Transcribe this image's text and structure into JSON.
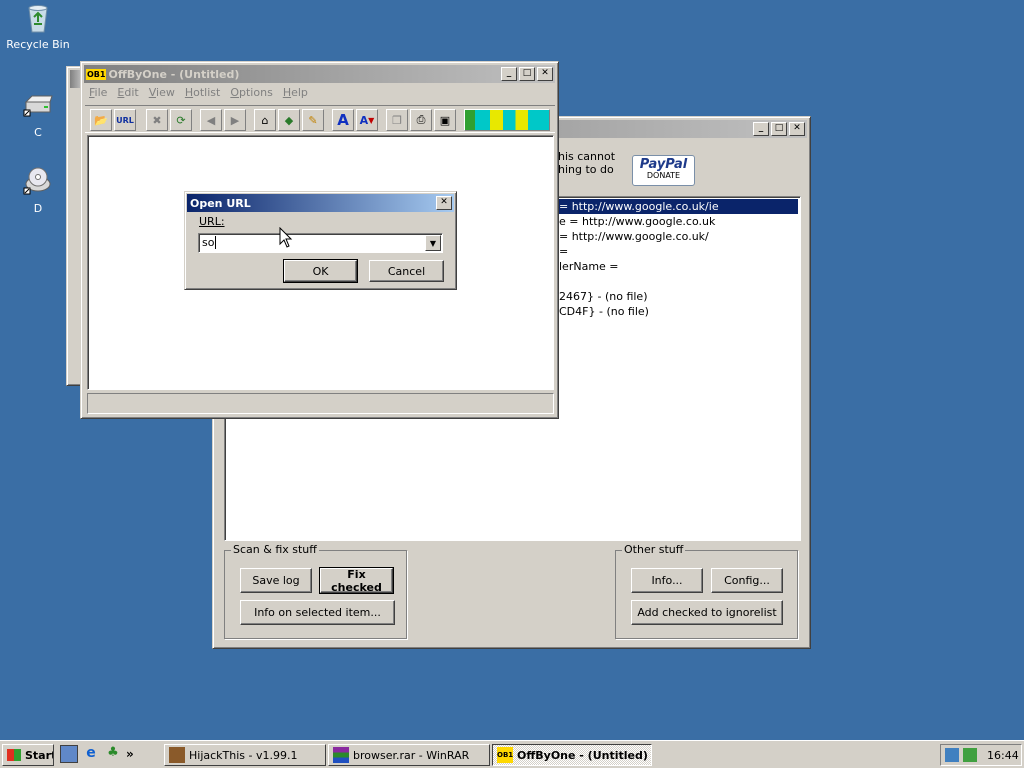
{
  "desktop": {
    "icons": [
      {
        "label": "Recycle Bin",
        "icon": "recycle-bin-icon"
      },
      {
        "label": "C",
        "icon": "drive-icon"
      },
      {
        "label": "D",
        "icon": "cd-drive-icon"
      }
    ]
  },
  "hijackthis": {
    "partial_text_line1": "his cannot",
    "partial_text_line2": "hing to do",
    "paypal_line1": "PayPal",
    "paypal_line2": "DONATE",
    "list_lines": [
      "= http://www.google.co.uk/ie",
      "e = http://www.google.co.uk",
      " = http://www.google.co.uk/",
      "=",
      "lerName =",
      "",
      "2467} - (no file)",
      "CD4F} - (no file)"
    ],
    "scan_group_label": "Scan & fix stuff",
    "save_log": "Save log",
    "fix_checked": "Fix checked",
    "info_selected": "Info on selected item...",
    "other_group_label": "Other stuff",
    "info": "Info...",
    "config": "Config...",
    "add_ignorelist": "Add checked to ignorelist"
  },
  "offbyone": {
    "title": "OffByOne - (Untitled)",
    "icon_text": "OB1",
    "menu": [
      "File",
      "Edit",
      "View",
      "Hotlist",
      "Options",
      "Help"
    ],
    "url_tool_label": "URL"
  },
  "open_url_dialog": {
    "title": "Open URL",
    "url_label": "URL:",
    "url_value": "so",
    "ok": "OK",
    "cancel": "Cancel"
  },
  "taskbar": {
    "start": "Start",
    "quicklaunch_more": "»",
    "tasks": [
      {
        "label": "HijackThis - v1.99.1",
        "active": false
      },
      {
        "label": "browser.rar - WinRAR",
        "active": false
      },
      {
        "label": "OffByOne - (Untitled)",
        "active": true
      }
    ],
    "clock": "16:44"
  }
}
